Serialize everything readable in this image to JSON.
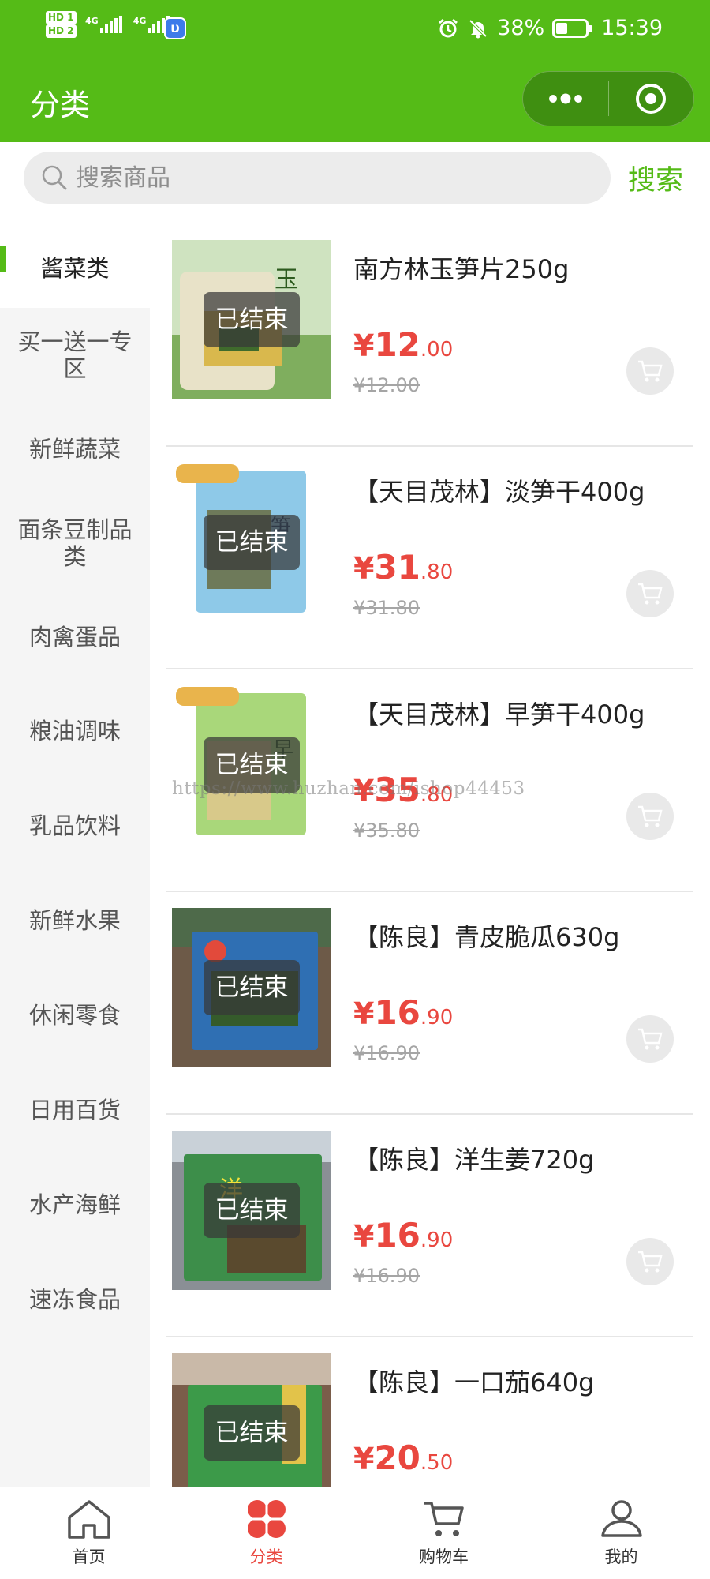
{
  "status_bar": {
    "sim1": "HD 1",
    "sim2": "HD 2",
    "net1": "4G",
    "net2": "4G",
    "battery_percent": "38%",
    "battery_level": 0.38,
    "time": "15:39"
  },
  "header": {
    "title": "分类"
  },
  "search": {
    "placeholder": "搜索商品",
    "button_label": "搜索"
  },
  "categories": [
    {
      "label": "酱菜类",
      "active": true
    },
    {
      "label": "买一送一专区",
      "active": false
    },
    {
      "label": "新鲜蔬菜",
      "active": false
    },
    {
      "label": "面条豆制品类",
      "active": false
    },
    {
      "label": "肉禽蛋品",
      "active": false
    },
    {
      "label": "粮油调味",
      "active": false
    },
    {
      "label": "乳品饮料",
      "active": false
    },
    {
      "label": "新鲜水果",
      "active": false
    },
    {
      "label": "休闲零食",
      "active": false
    },
    {
      "label": "日用百货",
      "active": false
    },
    {
      "label": "水产海鲜",
      "active": false
    },
    {
      "label": "速冻食品",
      "active": false
    }
  ],
  "products": [
    {
      "name": "南方林玉笋片250g",
      "status": "已结束",
      "currency": "¥",
      "price_int": "12",
      "price_dec": ".00",
      "original_price": "¥12.00",
      "image": "bamboo-shoot-slices-package"
    },
    {
      "name": "【天目茂林】淡笋干400g",
      "status": "已结束",
      "currency": "¥",
      "price_int": "31",
      "price_dec": ".80",
      "original_price": "¥31.80",
      "image": "dried-bamboo-shoot-package"
    },
    {
      "name": "【天目茂林】早笋干400g",
      "status": "已结束",
      "currency": "¥",
      "price_int": "35",
      "price_dec": ".80",
      "original_price": "¥35.80",
      "image": "early-bamboo-shoot-package"
    },
    {
      "name": "【陈良】青皮脆瓜630g",
      "status": "已结束",
      "currency": "¥",
      "price_int": "16",
      "price_dec": ".90",
      "original_price": "¥16.90",
      "image": "pickled-cucumber-package"
    },
    {
      "name": "【陈良】洋生姜720g",
      "status": "已结束",
      "currency": "¥",
      "price_int": "16",
      "price_dec": ".90",
      "original_price": "¥16.90",
      "image": "pickled-ginger-package"
    },
    {
      "name": "【陈良】一口茄640g",
      "status": "已结束",
      "currency": "¥",
      "price_int": "20",
      "price_dec": ".50",
      "original_price": "",
      "image": "pickled-eggplant-package"
    }
  ],
  "watermark": "https://www.huzhan.com/ishop44453",
  "tabbar": [
    {
      "label": "首页",
      "icon": "home-icon",
      "active": false
    },
    {
      "label": "分类",
      "icon": "category-icon",
      "active": true
    },
    {
      "label": "购物车",
      "icon": "cart-icon",
      "active": false
    },
    {
      "label": "我的",
      "icon": "user-icon",
      "active": false
    }
  ],
  "colors": {
    "brand_green": "#55bb17",
    "price_red": "#e9473f",
    "sidebar_bg": "#f5f5f5"
  }
}
